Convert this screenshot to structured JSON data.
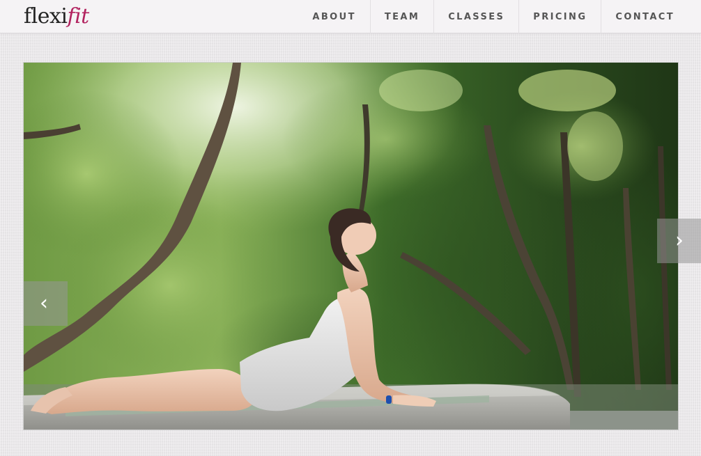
{
  "brand": {
    "logo_part1": "flexi",
    "logo_part2": "fit",
    "accent_color": "#b2225f"
  },
  "nav": {
    "items": [
      {
        "label": "ABOUT"
      },
      {
        "label": "TEAM"
      },
      {
        "label": "CLASSES"
      },
      {
        "label": "PRICING"
      },
      {
        "label": "CONTACT"
      }
    ]
  },
  "slider": {
    "prev_glyph": "‹",
    "next_glyph": "›"
  }
}
